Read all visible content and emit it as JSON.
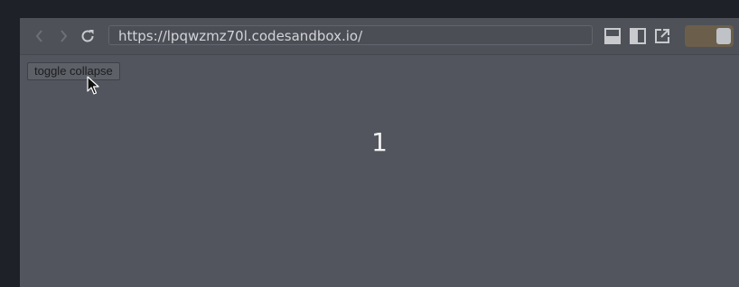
{
  "browser": {
    "url": "https://lpqwzmz70l.codesandbox.io/",
    "icons": {
      "back": "chevron-left-icon",
      "forward": "chevron-right-icon",
      "reload": "reload-icon",
      "layout_bottom": "layout-bottom-panel-icon",
      "layout_side": "layout-side-panel-icon",
      "open_external": "open-external-icon"
    },
    "toggle": {
      "state": "on",
      "color": "#6b5f4c"
    }
  },
  "app": {
    "toggle_button_label": "toggle collapse",
    "counter_value": "1"
  },
  "colors": {
    "page_background": "#1f2128",
    "frame_background": "#51545c",
    "text": "#f2f2f2"
  }
}
